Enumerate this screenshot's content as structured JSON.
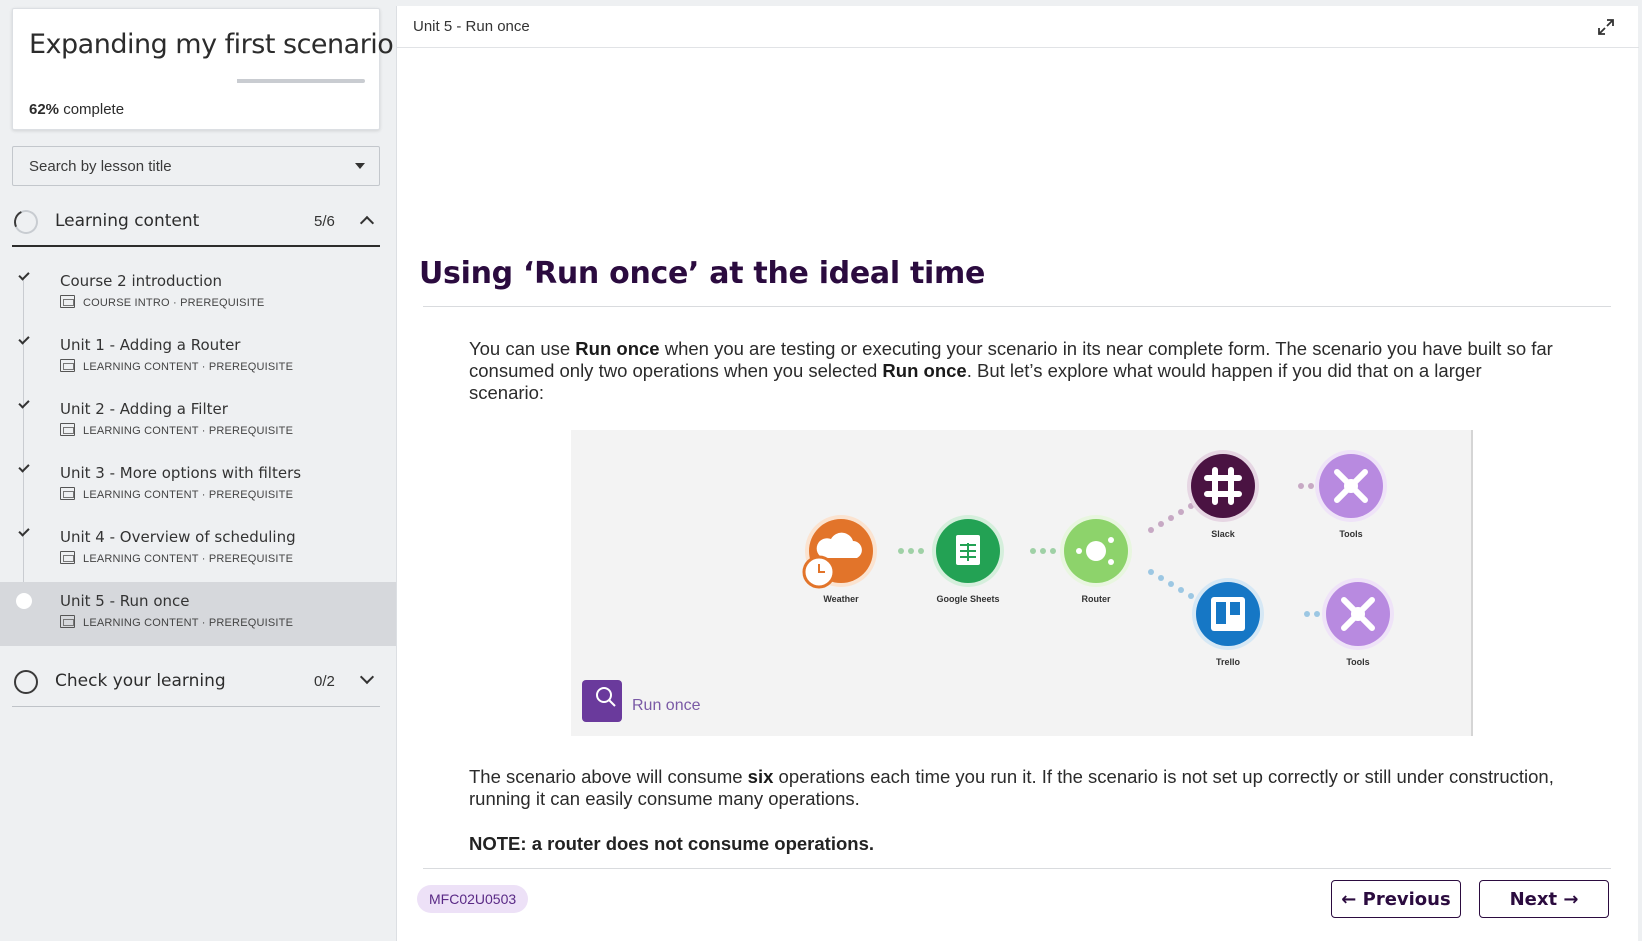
{
  "course": {
    "title": "Expanding my first scenario",
    "progress_percent": "62%",
    "progress_suffix": " complete",
    "progress_fraction": 0.62
  },
  "search": {
    "placeholder": "Search by lesson title"
  },
  "sections": [
    {
      "label": "Learning content",
      "count": "5/6",
      "state": "expanded"
    },
    {
      "label": "Check your learning",
      "count": "0/2",
      "state": "collapsed"
    }
  ],
  "lessons": [
    {
      "title": "Course 2 introduction",
      "meta": "COURSE INTRO · PREREQUISITE",
      "status": "done"
    },
    {
      "title": "Unit 1 - Adding a Router",
      "meta": "LEARNING CONTENT · PREREQUISITE",
      "status": "done"
    },
    {
      "title": "Unit 2 - Adding a Filter",
      "meta": "LEARNING CONTENT · PREREQUISITE",
      "status": "done"
    },
    {
      "title": "Unit 3 - More options with filters",
      "meta": "LEARNING CONTENT · PREREQUISITE",
      "status": "done"
    },
    {
      "title": "Unit 4 - Overview of scheduling",
      "meta": "LEARNING CONTENT · PREREQUISITE",
      "status": "done"
    },
    {
      "title": "Unit 5 - Run once",
      "meta": "LEARNING CONTENT · PREREQUISITE",
      "status": "current"
    }
  ],
  "header": {
    "breadcrumb": "Unit 5 - Run once"
  },
  "content": {
    "heading": "Using ‘Run once’ at the ideal time",
    "p1_a": "You can use ",
    "p1_b": "Run once",
    "p1_c": " when you are testing or executing your scenario in its near complete form. The scenario you have built so far consumed only two operations when you selected ",
    "p1_d": "Run once",
    "p1_e": ". But let’s explore what would happen if you did that on a larger scenario:",
    "p2_a": "The scenario above will consume ",
    "p2_b": "six",
    "p2_c": " operations each time you run it. If the scenario is not set up correctly or still under construction, running it can easily consume many operations.",
    "note": "NOTE: a router does not consume operations."
  },
  "diagram": {
    "run_once_label": "Run once",
    "modules": {
      "weather": "Weather",
      "sheets": "Google Sheets",
      "router": "Router",
      "slack": "Slack",
      "tools_top": "Tools",
      "trello": "Trello",
      "tools_bottom": "Tools"
    },
    "colors": {
      "weather": "#e2742a",
      "sheets": "#23a254",
      "router": "#8dd36b",
      "slack": "#4a1342",
      "tools": "#b88ae0",
      "trello": "#1677c5",
      "run_button": "#6a3a9c"
    }
  },
  "footer": {
    "code": "MFC02U0503",
    "previous_label": "← Previous",
    "next_label": "Next →"
  }
}
